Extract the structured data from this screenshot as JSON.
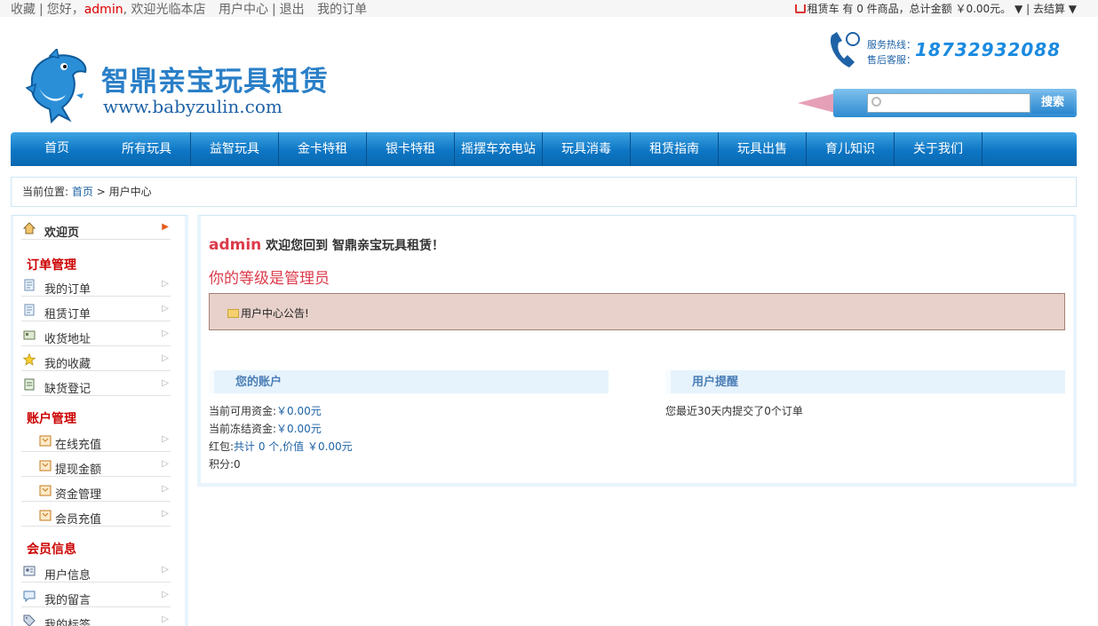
{
  "topbar": {
    "favorite": "收藏",
    "greeting_prefix": "您好，",
    "username": "admin",
    "greeting_suffix": ", 欢迎光临本店",
    "user_center": "用户中心",
    "logout": "退出",
    "my_orders": "我的订单",
    "cart_text": "租赁车 有 0 件商品，总计金额 ￥0.00元。",
    "cart_dropdown": "▼",
    "checkout": "去结算 ▼"
  },
  "header": {
    "brand_title": "智鼎亲宝玩具租赁",
    "brand_url": "www.babyzulin.com",
    "hotline_label": "服务热线：",
    "service_label": "售后客服：",
    "hotline_number": "18732932088",
    "search_placeholder": "",
    "search_button": "搜索"
  },
  "nav": {
    "items": [
      "首页",
      "所有玩具",
      "益智玩具",
      "金卡特租",
      "银卡特租",
      "摇摆车充电站",
      "玩具消毒",
      "租赁指南",
      "玩具出售",
      "育儿知识",
      "关于我们"
    ]
  },
  "breadcrumb": {
    "label": "当前位置:",
    "home": "首页",
    "separator": " > ",
    "current": "用户中心"
  },
  "sidebar": {
    "welcome": "欢迎页",
    "section_orders": "订单管理",
    "my_orders": "我的订单",
    "rent_orders": "租赁订单",
    "address": "收货地址",
    "favorites": "我的收藏",
    "shortage": "缺货登记",
    "section_account": "账户管理",
    "recharge": "在线充值",
    "withdraw": "提现金额",
    "funds": "资金管理",
    "member_recharge": "会员充值",
    "section_member": "会员信息",
    "user_info": "用户信息",
    "messages": "我的留言",
    "tags": "我的标签"
  },
  "main": {
    "username": "admin",
    "welcome_text": "欢迎您回到 智鼎亲宝玩具租赁！",
    "rank_text": "你的等级是管理员",
    "notice_title": "用户中心公告!",
    "account_title": "您的账户",
    "remind_title": "用户提醒",
    "available_label": "当前可用资金:",
    "available_value": "￥0.00元",
    "frozen_label": "当前冻结资金:",
    "frozen_value": "￥0.00元",
    "bonus_label": "红包:",
    "bonus_value": "共计 0 个,价值 ￥0.00元",
    "points_label": "积分:",
    "points_value": "0",
    "remind_text": "您最近30天内提交了0个订单"
  },
  "colors": {
    "nav_blue": "#0d76c4",
    "accent_red": "#cc0000",
    "link_blue": "#1e62a6",
    "notice_bg": "#e8d1cb"
  }
}
